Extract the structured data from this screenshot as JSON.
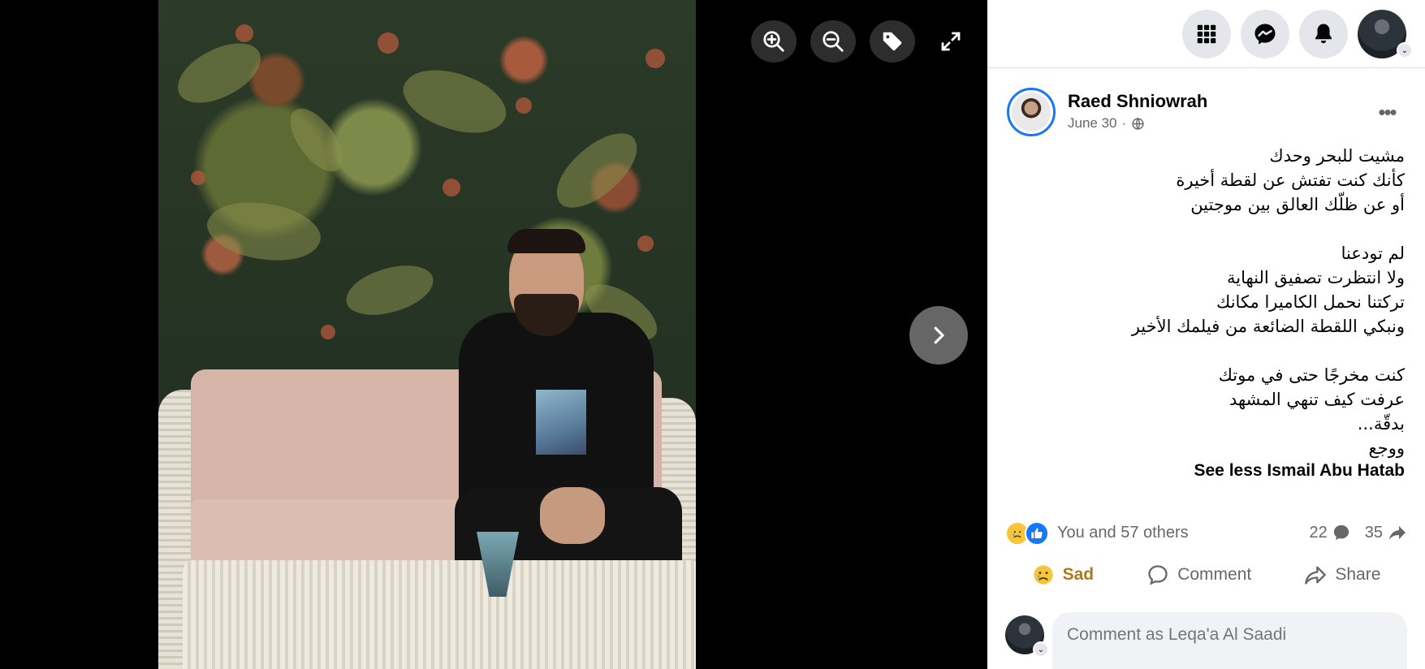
{
  "viewer": {
    "tools": {
      "zoom_in": "zoom-in-icon",
      "zoom_out": "zoom-out-icon",
      "tag": "tag-icon",
      "fullscreen": "fullscreen-icon"
    },
    "next": "chevron-right-icon"
  },
  "topbar": {
    "icons": [
      "menu-grid-icon",
      "messenger-icon",
      "notifications-bell-icon"
    ]
  },
  "post": {
    "author": "Raed Shniowrah",
    "date": "June 30",
    "separator": "·",
    "privacy_icon": "globe-icon",
    "more_label": "•••",
    "lines": [
      "مشيت للبحر وحدك",
      "كأنك كنت تفتش عن لقطة أخيرة",
      "أو عن ظلّك العالق بين موجتين",
      "",
      "لم تودعنا",
      "ولا انتظرت تصفيق النهاية",
      "تركتنا نحمل الكاميرا مكانك",
      "ونبكي اللقطة الضائعة من فيلمك الأخير",
      "",
      "كنت مخرجًا حتى في موتك",
      "عرفت كيف تنهي المشهد",
      "بدقّة...",
      "ووجع"
    ],
    "see_less": "See less Ismail Abu Hatab",
    "reactions_text": "You and 57 others",
    "comments_count": "22",
    "shares_count": "35"
  },
  "actions": {
    "sad": "Sad",
    "comment": "Comment",
    "share": "Share"
  },
  "comment_box": {
    "placeholder": "Comment as Leqa'a Al Saadi"
  },
  "colors": {
    "accent": "#1877f2",
    "sad_color": "#b0781c",
    "muted": "#65676b"
  }
}
